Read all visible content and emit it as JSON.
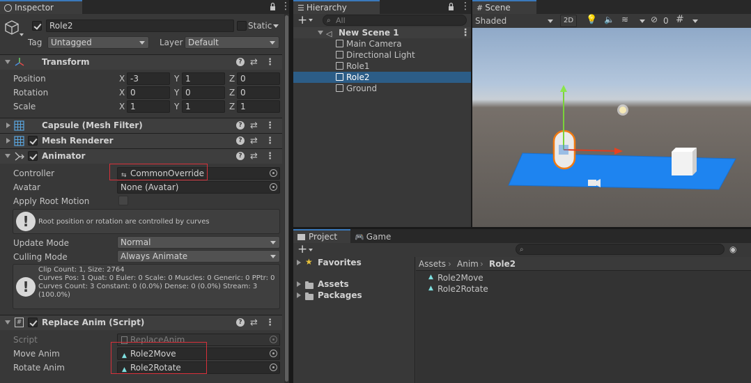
{
  "inspector": {
    "tab": "Inspector",
    "object_name": "Role2",
    "static_label": "Static",
    "tag_label": "Tag",
    "tag_value": "Untagged",
    "layer_label": "Layer",
    "layer_value": "Default",
    "transform": {
      "title": "Transform",
      "rows": [
        {
          "label": "Position",
          "x": "-3",
          "y": "1",
          "z": "0"
        },
        {
          "label": "Rotation",
          "x": "0",
          "y": "0",
          "z": "0"
        },
        {
          "label": "Scale",
          "x": "1",
          "y": "1",
          "z": "1"
        }
      ],
      "axis_x": "X",
      "axis_y": "Y",
      "axis_z": "Z"
    },
    "mesh_filter_title": "Capsule (Mesh Filter)",
    "mesh_renderer_title": "Mesh Renderer",
    "animator": {
      "title": "Animator",
      "controller_label": "Controller",
      "controller_value": "CommonOverride",
      "avatar_label": "Avatar",
      "avatar_value": "None (Avatar)",
      "apply_root_motion_label": "Apply Root Motion",
      "root_motion_help": "Root position or rotation are controlled by curves",
      "update_mode_label": "Update Mode",
      "update_mode_value": "Normal",
      "culling_mode_label": "Culling Mode",
      "culling_mode_value": "Always Animate",
      "clip_info_1": "Clip Count: 1, Size: 2764",
      "clip_info_2": "Curves Pos: 1 Quat: 0 Euler: 0 Scale: 0 Muscles: 0 Generic: 0 PPtr: 0",
      "clip_info_3": "Curves Count: 3 Constant: 0 (0.0%) Dense: 0 (0.0%) Stream: 3",
      "clip_info_4": "(100.0%)"
    },
    "replace_anim": {
      "title": "Replace Anim (Script)",
      "script_label": "Script",
      "script_value": "ReplaceAnim",
      "move_label": "Move Anim",
      "move_value": "Role2Move",
      "rotate_label": "Rotate Anim",
      "rotate_value": "Role2Rotate"
    }
  },
  "hierarchy": {
    "tab": "Hierarchy",
    "search_placeholder": "All",
    "scene_name": "New Scene 1",
    "items": [
      "Main Camera",
      "Directional Light",
      "Role1",
      "Role2",
      "Ground"
    ],
    "selected_index": 3
  },
  "scene": {
    "tab": "Scene",
    "shading": "Shaded",
    "mode_2d": "2D",
    "hidden_count": "0"
  },
  "project": {
    "tab_project": "Project",
    "tab_game": "Game",
    "favorites": "Favorites",
    "assets": "Assets",
    "packages": "Packages",
    "breadcrumb": [
      "Assets",
      "Anim",
      "Role2"
    ],
    "files": [
      "Role2Move",
      "Role2Rotate"
    ]
  },
  "colors": {
    "selection": "#2c5d87",
    "highlight_box": "#d9303a",
    "tab_accent": "#3a79bb"
  }
}
